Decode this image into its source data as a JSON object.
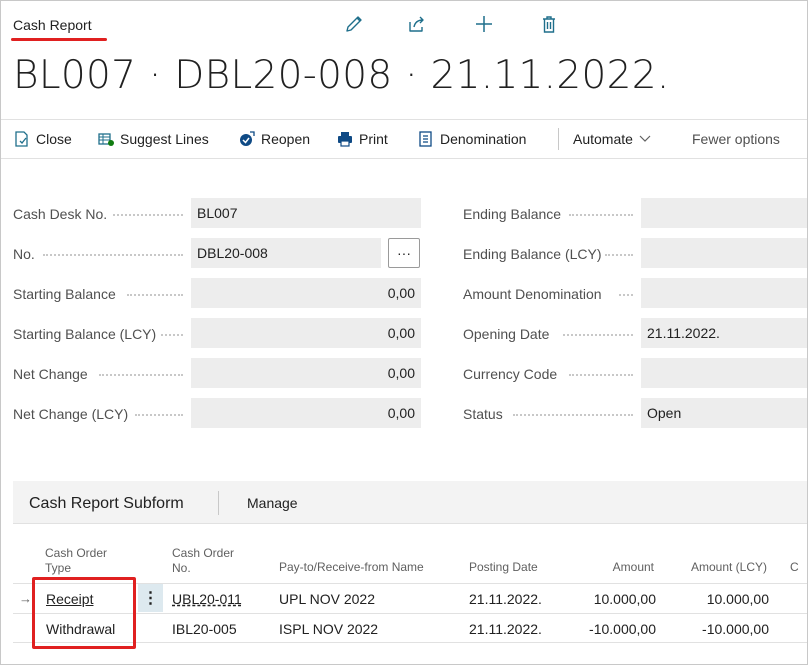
{
  "header": {
    "caption": "Cash Report",
    "title": "BL007 · DBL20-008 · 21.11.2022.",
    "icons": [
      "pencil-icon",
      "share-icon",
      "plus-icon",
      "trash-icon"
    ]
  },
  "actions": {
    "close": "Close",
    "suggest_lines": "Suggest Lines",
    "reopen": "Reopen",
    "print": "Print",
    "denomination": "Denomination",
    "automate": "Automate",
    "fewer_options": "Fewer options"
  },
  "fields": {
    "cash_desk_no": {
      "label": "Cash Desk No.",
      "value": "BL007"
    },
    "no": {
      "label": "No.",
      "value": "DBL20-008",
      "button": "···"
    },
    "starting_balance": {
      "label": "Starting Balance",
      "value": "0,00"
    },
    "starting_balance_lcy": {
      "label": "Starting Balance (LCY)",
      "value": "0,00"
    },
    "net_change": {
      "label": "Net Change",
      "value": "0,00"
    },
    "net_change_lcy": {
      "label": "Net Change (LCY)",
      "value": "0,00"
    },
    "ending_balance": {
      "label": "Ending Balance",
      "value": ""
    },
    "ending_balance_lcy": {
      "label": "Ending Balance (LCY)",
      "value": ""
    },
    "amount_denomination": {
      "label": "Amount Denomination",
      "value": ""
    },
    "opening_date": {
      "label": "Opening Date",
      "value": "21.11.2022."
    },
    "currency_code": {
      "label": "Currency Code",
      "value": ""
    },
    "status": {
      "label": "Status",
      "value": "Open"
    }
  },
  "subform": {
    "title": "Cash Report Subform",
    "manage": "Manage",
    "columns": {
      "type_1": "Cash Order",
      "type_2": "Type",
      "no_1": "Cash Order",
      "no_2": "No.",
      "name": "Pay-to/Receive-from Name",
      "posting_date": "Posting Date",
      "amount": "Amount",
      "amount_lcy": "Amount (LCY)",
      "next": "C"
    },
    "rows": [
      {
        "type": "Receipt",
        "no": "UBL20-011",
        "name": "UPL NOV 2022",
        "date": "21.11.2022.",
        "amount": "10.000,00",
        "amount_lcy": "10.000,00"
      },
      {
        "type": "Withdrawal",
        "no": "IBL20-005",
        "name": "ISPL NOV 2022",
        "date": "21.11.2022.",
        "amount": "-10.000,00",
        "amount_lcy": "-10.000,00"
      }
    ],
    "row_menu": "⋮",
    "row_arrow": "→"
  },
  "colors": {
    "accent": "#e02020",
    "field_bg": "#ededed",
    "icon_blue": "#1f6f8b",
    "icon_green": "#107c10",
    "icon_dark_blue": "#0f4a85"
  }
}
